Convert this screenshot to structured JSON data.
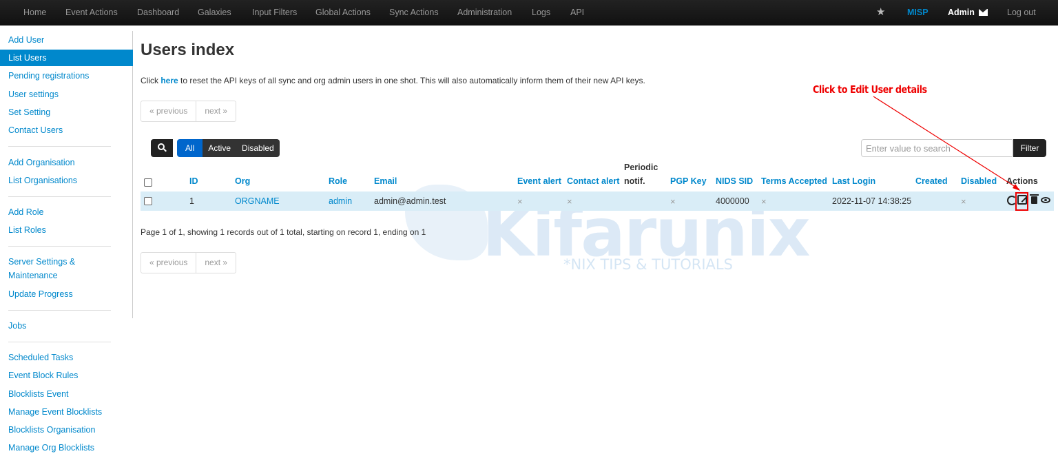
{
  "navbar": {
    "items": [
      "Home",
      "Event Actions",
      "Dashboard",
      "Galaxies",
      "Input Filters",
      "Global Actions",
      "Sync Actions",
      "Administration",
      "Logs",
      "API"
    ],
    "brand": "MISP",
    "user": "Admin",
    "logout": "Log out"
  },
  "sidebar": {
    "items": [
      {
        "label": "Add User"
      },
      {
        "label": "List Users",
        "active": true
      },
      {
        "label": "Pending registrations"
      },
      {
        "label": "User settings"
      },
      {
        "label": "Set Setting"
      },
      {
        "label": "Contact Users"
      },
      {
        "label": "Add Organisation"
      },
      {
        "label": "List Organisations"
      },
      {
        "label": "Add Role"
      },
      {
        "label": "List Roles"
      },
      {
        "label": "Server Settings &"
      },
      {
        "label": "Maintenance"
      },
      {
        "label": "Update Progress"
      },
      {
        "label": "Jobs"
      },
      {
        "label": "Scheduled Tasks"
      },
      {
        "label": "Event Block Rules"
      },
      {
        "label": "Blocklists Event"
      },
      {
        "label": "Manage Event Blocklists"
      },
      {
        "label": "Blocklists Organisation"
      },
      {
        "label": "Manage Org Blocklists"
      }
    ]
  },
  "page": {
    "title": "Users index",
    "info_prefix": "Click ",
    "info_link": "here",
    "info_suffix": " to reset the API keys of all sync and org admin users in one shot. This will also automatically inform them of their new API keys.",
    "pager": {
      "previous": "« previous",
      "next": "next »"
    },
    "filters": [
      "All",
      "Active",
      "Disabled"
    ],
    "filter_placeholder": "Enter value to search",
    "filter_button": "Filter",
    "summary": "Page 1 of 1, showing 1 records out of 1 total, starting on record 1, ending on 1"
  },
  "table": {
    "columns": {
      "id": "ID",
      "org": "Org",
      "role": "Role",
      "email": "Email",
      "event_alert": "Event alert",
      "contact_alert": "Contact alert",
      "periodic_1": "Periodic",
      "periodic_2": "notif.",
      "pgp_key": "PGP Key",
      "nids_sid": "NIDS SID",
      "terms": "Terms Accepted",
      "last_login": "Last Login",
      "created": "Created",
      "disabled": "Disabled",
      "actions": "Actions"
    },
    "rows": [
      {
        "id": "1",
        "org": "ORGNAME",
        "role": "admin",
        "email": "admin@admin.test",
        "event_alert": "×",
        "contact_alert": "×",
        "pgp_key": "×",
        "nids_sid": "4000000",
        "terms": "×",
        "last_login": "2022-11-07 14:38:25",
        "disabled": "×"
      }
    ],
    "action_icons": [
      "sync-icon",
      "edit-icon",
      "trash-icon",
      "eye-icon"
    ]
  },
  "annotation": {
    "text": "Click to Edit User details",
    "color": "#e00000"
  },
  "watermark": {
    "word": "Kifarunix",
    "tagline": "*NIX TIPS & TUTORIALS"
  },
  "colors": {
    "accent": "#0088cc",
    "navbar": "#1b1b1b",
    "row_highlight": "#d9edf7"
  }
}
